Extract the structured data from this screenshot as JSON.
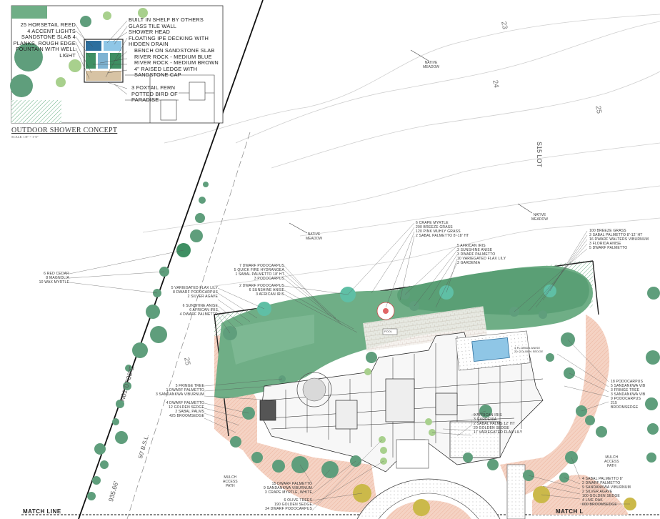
{
  "inset": {
    "title": "OUTDOOR SHOWER CONCEPT",
    "scale": "SCALE: 1/8\" = 1'-0\"",
    "left_labels": [
      "25 HORSETAIL REED",
      "4 ACCENT LIGHTS",
      "SANDSTONE SLAB 4",
      "PLANKS, ROUGH EDGE",
      "FOUNTAIN WITH WELL",
      "LIGHT"
    ],
    "right_labels": [
      "BUILT IN SHELF BY OTHERS",
      "GLASS TILE WALL",
      "SHOWER HEAD",
      "FLOATING IPE DECKING WITH",
      "HIDDEN DRAIN",
      "BENCH ON SANDSTONE SLAB",
      "RIVER ROCK - MEDIUM BLUE",
      "RIVER ROCK - MEDIUM BROWN",
      "4\" RAISED LEDGE WITH",
      "SANDSTONE CAP",
      "3 FOXTAIL FERN",
      "POTTED BIRD OF",
      "PARADISE"
    ]
  },
  "tags": {
    "native_meadow_1": [
      "NATIVE",
      "MEADOW"
    ],
    "native_meadow_2": [
      "NATIVE",
      "MEADOW"
    ],
    "native_meadow_3": [
      "NATIVE",
      "MEADOW"
    ],
    "mulch_left": [
      "MULCH",
      "ACCESS",
      "PATH"
    ],
    "mulch_right": [
      "MULCH",
      "ACCESS",
      "PATH"
    ],
    "pool_label": "POOL"
  },
  "contours": [
    "23",
    "24",
    "25",
    "25"
  ],
  "survey": {
    "bearing": "N01°07'30\"E",
    "distance": "935.66'",
    "setback": "50' B.S.L.",
    "rear_line": "S15 LOT"
  },
  "match_lines": [
    "MATCH LINE",
    "MATCH L"
  ],
  "callouts": {
    "west": [
      "6 RED CEDAR",
      "8 MAGNOLIA",
      "10 WAX MYRTLE"
    ],
    "center_top": [
      "6 CRAPE MYRTLE",
      "200 BREEZE GRASS",
      "120 PINK MUHLY GRASS",
      "2 SABAL PALMETTO 8'-18' HT",
      "5 AFRICAN IRIS",
      "3 SUNSHINE ANISE",
      "3 DWARF PALMETTO",
      "10 VARIEGATED FLAX LILY",
      "3 GARDENIA"
    ],
    "center_left": [
      "7 DWARF PODOCARPUS",
      "5 QUICK FIRE HYDRANGEA",
      "1 SABAL PALMETTO 18' HT",
      "3 PODOCARPUS",
      "2 DWARF PODOCARPUS",
      "6 SUNSHINE ANISE",
      "3 AFRICAN IRIS"
    ],
    "west_mid": [
      "5 VARIEGATED FLAX LILY",
      "8 DWARF PODOCARPUS",
      "2 SILVER AGAVE",
      "6 SUNSHINE ANISE",
      "6 AFRICAN IRIS",
      "4 DWARF PALMETTO"
    ],
    "west_low": [
      "5 FRINGE TREE",
      "1 DWARF PALMETTO",
      "3 SANDANKWA VIBURNUM",
      "4 DWARF PALMETTO",
      "12 GOLDEN SEDGE",
      "2 SABAL PALMS",
      "425 BROOMSEDGE"
    ],
    "east_top": [
      "100 BREEZE GRASS",
      "3 SABAL PALMETTO 8'-12' HT",
      "16 DWARF WALTERS VIBURNUM",
      "3 FLORIDA ANISE",
      "5 DWARF PALMETTO"
    ],
    "east_mid": [
      "18 PODOCARPUS",
      "5 SANDANKWA VIB",
      "3 FRINGE TREE",
      "3 SANDANKWA VIB",
      "9 PODOCARPUS",
      "215",
      "BROOMSEDGE"
    ],
    "center_low": [
      "9 AFRICAN IRIS",
      "3 GARDENIA",
      "2 SABAL PALMS 12' HT",
      "20 GOLDEN SEDGE",
      "17 VARIEGATED FLAX LILY"
    ],
    "pool_notes": [
      "4 FLORIDA ANISE",
      "20 GOLDEN SEDGE"
    ],
    "bottom_center": [
      "15 DWARF PALMETTO",
      "9 SANDANKWA VIBURNUM",
      "3 CRAPE MYRTLE, WHITE",
      "6 OLIVE TREES",
      "190 GOLDEN SEDGE",
      "34 DWARF PODOCARPUS"
    ],
    "bottom_right": [
      "4 SABAL PALMETTO 8'",
      "2 DWARF PALMETTO",
      "9 SANDANKWA VIBURNUM",
      "2 SILVER AGAVE",
      "100 GOLDEN SEDGE",
      "4 LIVE OAK",
      "600 BROOMSEDGE"
    ]
  },
  "colors": {
    "lawn": "#6fae86",
    "lawn_dark": "#3f8f63",
    "tree": "#5f9e7c",
    "mulch": "#f3c9b8",
    "pool": "#8fc6e6",
    "palm": "#cbb94a",
    "line": "#222222"
  }
}
